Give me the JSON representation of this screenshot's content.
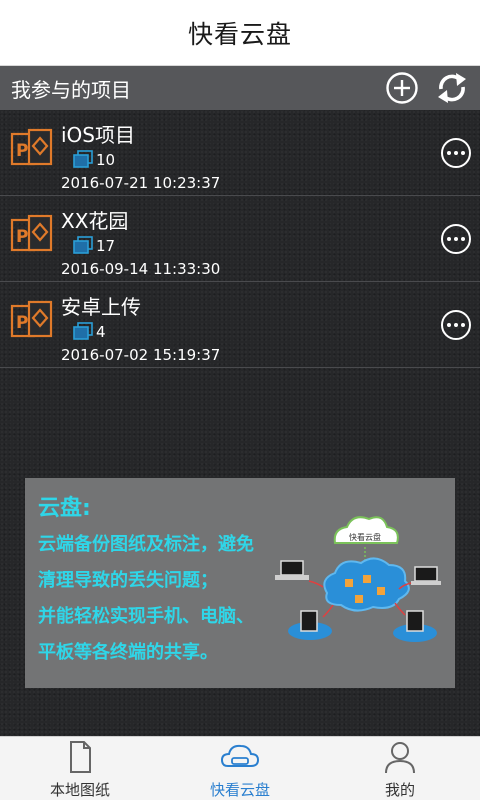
{
  "header": {
    "title": "快看云盘"
  },
  "subheader": {
    "title": "我参与的项目",
    "add_icon": "plus-circle-icon",
    "sync_icon": "sync-arrows-icon"
  },
  "projects": [
    {
      "name": "iOS项目",
      "count": "10",
      "time": "2016-07-21 10:23:37"
    },
    {
      "name": "XX花园",
      "count": "17",
      "time": "2016-09-14 11:33:30"
    },
    {
      "name": "安卓上传",
      "count": "4",
      "time": "2016-07-02 15:19:37"
    }
  ],
  "banner": {
    "title": "云盘:",
    "lines": [
      "云端备份图纸及标注，避免",
      "清理导致的丢失问题；",
      "并能轻松实现手机、电脑、",
      "平板等各终端的共享。"
    ],
    "cloud_label": "快看云盘"
  },
  "tabbar": {
    "tabs": [
      {
        "label": "本地图纸",
        "icon": "document-icon",
        "active": false
      },
      {
        "label": "快看云盘",
        "icon": "cloud-icon",
        "active": true
      },
      {
        "label": "我的",
        "icon": "person-icon",
        "active": false
      }
    ]
  },
  "colors": {
    "accent": "#2a7fcf",
    "banner_text": "#2fd6e8",
    "project_icon": "#e07a2a",
    "subbar": "#56575a"
  }
}
